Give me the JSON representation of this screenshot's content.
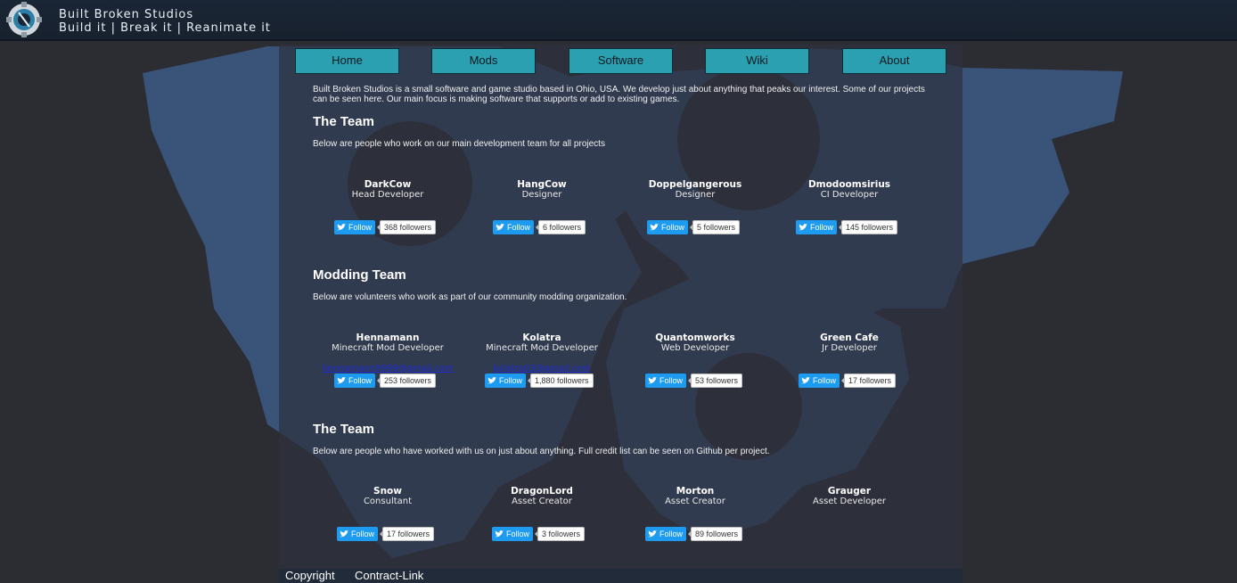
{
  "brand": {
    "title": "Built Broken Studios",
    "tagline": "Build it | Break it | Reanimate it"
  },
  "nav": [
    {
      "label": "Home"
    },
    {
      "label": "Mods"
    },
    {
      "label": "Software"
    },
    {
      "label": "Wiki"
    },
    {
      "label": "About"
    }
  ],
  "intro": "Built Broken Studios is a small software and game studio based in Ohio, USA. We develop just about anything that peaks our interest. Some of our projects can be seen here. Our main focus is making software that supports or add to existing games.",
  "follow_label": "Follow",
  "sections": [
    {
      "title": "The Team",
      "description": "Below are people who work on our main development team for all projects",
      "members": [
        {
          "name": "DarkCow",
          "role": "Head Developer",
          "followers": "368 followers"
        },
        {
          "name": "HangCow",
          "role": "Designer",
          "followers": "6 followers"
        },
        {
          "name": "Doppelgangerous",
          "role": "Designer",
          "followers": "5 followers"
        },
        {
          "name": "Dmodoomsirius",
          "role": "CI Developer",
          "followers": "145 followers"
        }
      ]
    },
    {
      "title": "Modding Team",
      "description": "Below are volunteers who work as part of our community modding organization.",
      "members": [
        {
          "name": "Hennamann",
          "role": "Minecraft Mod Developer",
          "email": "hennamann9999@gmail.com",
          "followers": "253 followers"
        },
        {
          "name": "Kolatra",
          "role": "Minecraft Mod Developer",
          "email": "kolatra03@gmail.com",
          "followers": "1,880 followers"
        },
        {
          "name": "Quantomworks",
          "role": "Web Developer",
          "followers": "53 followers"
        },
        {
          "name": "Green Cafe",
          "role": "Jr Developer",
          "followers": "17 followers"
        }
      ]
    },
    {
      "title": "The Team",
      "description": "Below are people who have worked with us on just about anything. Full credit list can be seen on Github per project.",
      "members": [
        {
          "name": "Snow",
          "role": "Consultant",
          "followers": "17 followers"
        },
        {
          "name": "DragonLord",
          "role": "Asset Creator",
          "followers": "3 followers"
        },
        {
          "name": "Morton",
          "role": "Asset Creator",
          "followers": "89 followers"
        },
        {
          "name": "Grauger",
          "role": "Asset Developer"
        }
      ]
    }
  ],
  "footer": {
    "copyright": "Copyright",
    "contract_link": "Contract-Link"
  },
  "colors": {
    "nav_button": "#2aa0b0",
    "header": "#1a2535",
    "gear": "#3d5a86",
    "twitter": "#1d9bf0"
  }
}
